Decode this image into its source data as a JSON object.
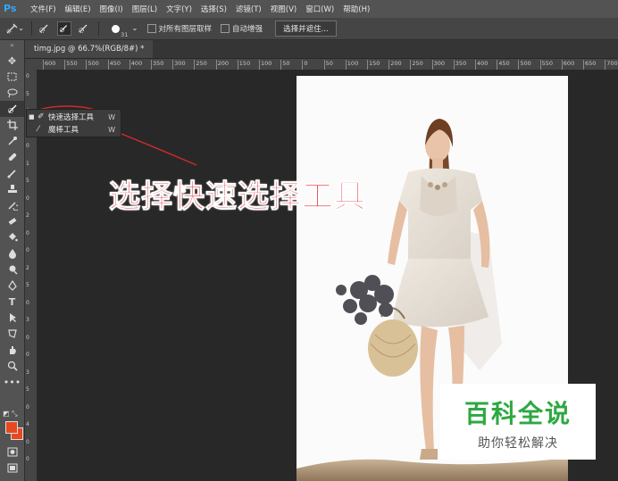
{
  "app": {
    "logo": "Ps"
  },
  "menubar": {
    "items": [
      "文件(F)",
      "编辑(E)",
      "图像(I)",
      "图层(L)",
      "文字(Y)",
      "选择(S)",
      "滤镜(T)",
      "视图(V)",
      "窗口(W)",
      "帮助(H)"
    ]
  },
  "options": {
    "brush_size": "31",
    "sample_all_layers_label": "对所有图层取样",
    "auto_enhance_label": "自动增强",
    "select_mask_button": "选择并遮住..."
  },
  "document": {
    "tab_label": "timg.jpg @ 66.7%(RGB/8#) *"
  },
  "rulers": {
    "horizontal": [
      "600",
      "550",
      "500",
      "450",
      "400",
      "350",
      "300",
      "250",
      "200",
      "150",
      "100",
      "50",
      "0",
      "50",
      "100",
      "150",
      "200",
      "250",
      "300",
      "350",
      "400",
      "450",
      "500",
      "550",
      "600",
      "650",
      "700"
    ],
    "vertical": [
      "0",
      "5",
      "0",
      "1",
      "0",
      "1",
      "5",
      "0",
      "2",
      "0",
      "0",
      "2",
      "5",
      "0",
      "3",
      "0",
      "0",
      "3",
      "5",
      "0",
      "4",
      "0",
      "0"
    ]
  },
  "tool_flyout": {
    "items": [
      {
        "label": "快速选择工具",
        "key": "W",
        "icon": "quick-selection-icon",
        "checked": true
      },
      {
        "label": "魔棒工具",
        "key": "W",
        "icon": "magic-wand-icon",
        "checked": false
      }
    ]
  },
  "annotation": {
    "text": "选择快速选择工具",
    "color": "#e0212a",
    "ellipse_color": "#d42a2a"
  },
  "watermark": {
    "title": "百科全说",
    "subtitle": "助你轻松解决",
    "title_color": "#2ea842"
  },
  "colors": {
    "foreground": "#e8481f",
    "background": "#e8481f"
  }
}
